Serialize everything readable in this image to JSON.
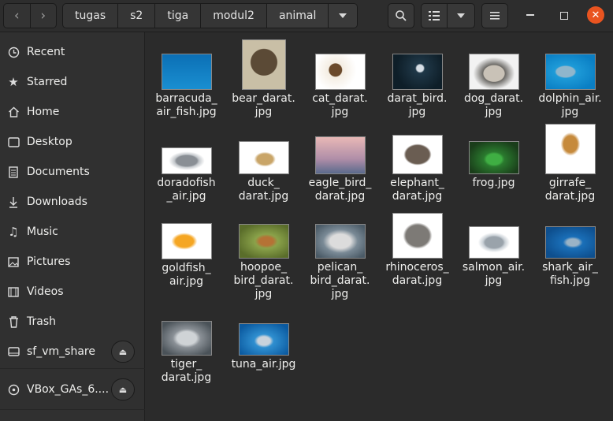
{
  "header": {
    "breadcrumbs": [
      "tugas",
      "s2",
      "tiga",
      "modul2",
      "animal"
    ]
  },
  "sidebar": {
    "items": [
      {
        "label": "Recent",
        "icon": "clock-icon"
      },
      {
        "label": "Starred",
        "icon": "star-icon"
      },
      {
        "label": "Home",
        "icon": "home-icon"
      },
      {
        "label": "Desktop",
        "icon": "desktop-icon"
      },
      {
        "label": "Documents",
        "icon": "documents-icon"
      },
      {
        "label": "Downloads",
        "icon": "downloads-icon"
      },
      {
        "label": "Music",
        "icon": "music-icon"
      },
      {
        "label": "Pictures",
        "icon": "pictures-icon"
      },
      {
        "label": "Videos",
        "icon": "videos-icon"
      },
      {
        "label": "Trash",
        "icon": "trash-icon"
      },
      {
        "label": "sf_vm_share",
        "icon": "drive-icon"
      },
      {
        "label": "VBox_GAs_6....",
        "icon": "disc-icon"
      }
    ]
  },
  "files": [
    {
      "name": "barracuda_\nair_fish.jpg"
    },
    {
      "name": "bear_darat.\njpg"
    },
    {
      "name": "cat_darat.\njpg"
    },
    {
      "name": "darat_bird.\njpg"
    },
    {
      "name": "dog_darat.\njpg"
    },
    {
      "name": "dolphin_air.\njpg"
    },
    {
      "name": "doradofish\n_air.jpg"
    },
    {
      "name": "duck_\ndarat.jpg"
    },
    {
      "name": "eagle_bird_\ndarat.jpg"
    },
    {
      "name": "elephant_\ndarat.jpg"
    },
    {
      "name": "frog.jpg"
    },
    {
      "name": "girrafe_\ndarat.jpg"
    },
    {
      "name": "goldfish_\nair.jpg"
    },
    {
      "name": "hoopoe_\nbird_darat.\njpg"
    },
    {
      "name": "pelican_\nbird_darat.\njpg"
    },
    {
      "name": "rhinoceros_\ndarat.jpg"
    },
    {
      "name": "salmon_air.\njpg"
    },
    {
      "name": "shark_air_\nfish.jpg"
    },
    {
      "name": "tiger_\ndarat.jpg"
    },
    {
      "name": "tuna_air.jpg"
    }
  ],
  "colors": {
    "accent": "#e95420"
  }
}
